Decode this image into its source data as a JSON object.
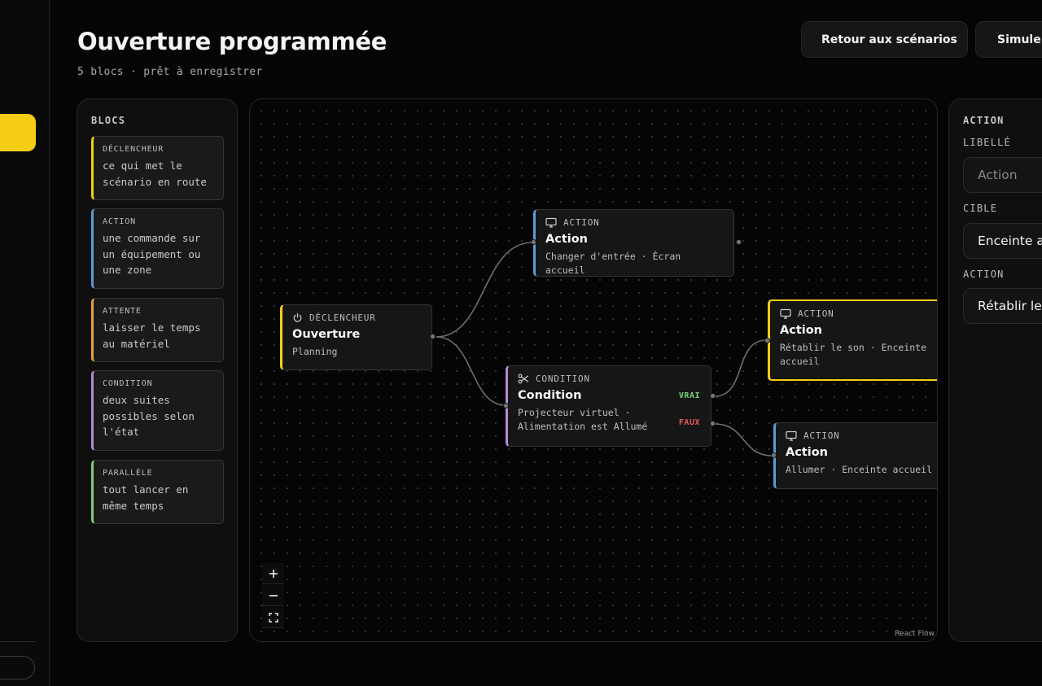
{
  "header": {
    "title": "Ouverture programmée",
    "subtitle": "5 blocs · prêt à enregistrer",
    "back_button": "Retour aux scénarios",
    "simulate_button": "Simule"
  },
  "palette": {
    "heading": "BLOCS",
    "items": [
      {
        "kind": "DÉCLENCHEUR",
        "description": "ce qui met le scénario en route",
        "color": "#f5cd15"
      },
      {
        "kind": "ACTION",
        "description": "une commande sur un équipement ou une zone",
        "color": "#5b9bd5"
      },
      {
        "kind": "ATTENTE",
        "description": "laisser le temps au matériel",
        "color": "#e8a33c"
      },
      {
        "kind": "CONDITION",
        "description": "deux suites possibles selon l'état",
        "color": "#b48ad8"
      },
      {
        "kind": "PARALLÈLE",
        "description": "tout lancer en même temps",
        "color": "#7dc77f"
      }
    ]
  },
  "nodes": {
    "trigger": {
      "kind": "DÉCLENCHEUR",
      "title": "Ouverture",
      "subtitle": "Planning",
      "icon": "power-icon"
    },
    "action_top": {
      "kind": "ACTION",
      "title": "Action",
      "subtitle": "Changer d'entrée · Écran accueil",
      "icon": "monitor-icon"
    },
    "condition": {
      "kind": "CONDITION",
      "title": "Condition",
      "subtitle": "Projecteur virtuel · Alimentation est Allumé",
      "true_label": "VRAI",
      "false_label": "FAUX",
      "icon": "branch-icon"
    },
    "action_selected": {
      "kind": "ACTION",
      "title": "Action",
      "subtitle": "Rétablir le son · Enceinte accueil",
      "icon": "monitor-icon"
    },
    "action_bottom": {
      "kind": "ACTION",
      "title": "Action",
      "subtitle": "Allumer · Enceinte accueil",
      "icon": "monitor-icon"
    }
  },
  "canvas": {
    "attribution": "React Flow",
    "controls": [
      "zoom-in",
      "zoom-out",
      "fit-view"
    ]
  },
  "inspector": {
    "heading": "ACTION",
    "label_label": "LIBELLÉ",
    "label_placeholder": "Action",
    "target_label": "CIBLE",
    "target_value": "Enceinte accueil",
    "action_label": "ACTION",
    "action_value": "Rétablir le son"
  },
  "colors": {
    "accent": "#f5cd15",
    "action": "#5b9bd5",
    "condition": "#b48ad8",
    "true": "#7bd67a",
    "false": "#e25b5b"
  }
}
